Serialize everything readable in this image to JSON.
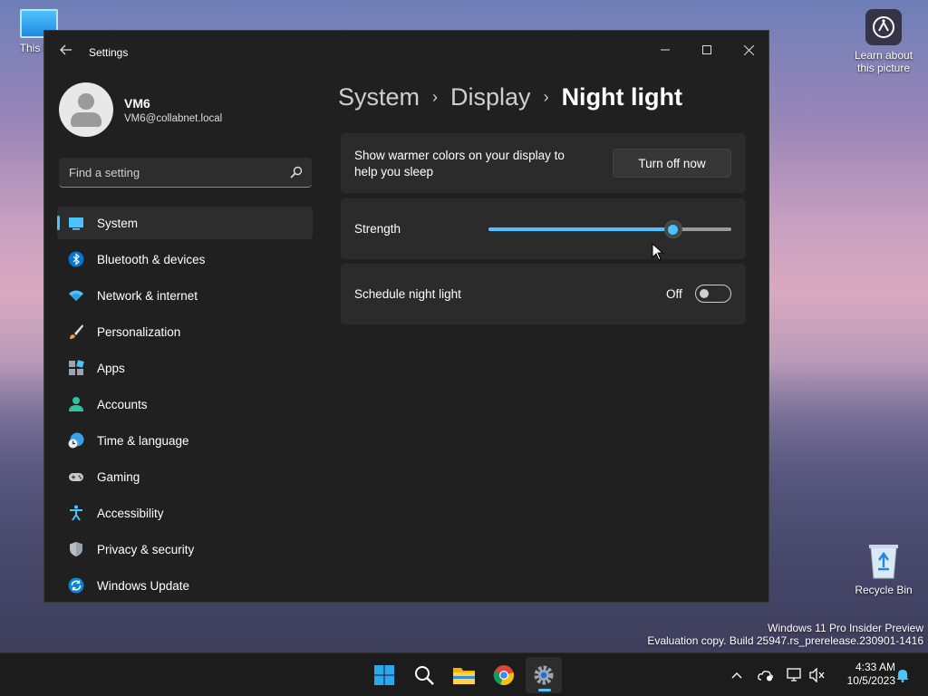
{
  "desktop": {
    "icons": [
      {
        "label": "This PC"
      },
      {
        "label": "Learn about this picture"
      },
      {
        "label": "Recycle Bin"
      }
    ],
    "watermark": {
      "line1": "Windows 11 Pro Insider Preview",
      "line2": "Evaluation copy. Build 25947.rs_prerelease.230901-1416"
    }
  },
  "window": {
    "title": "Settings",
    "user": {
      "name": "VM6",
      "email": "VM6@collabnet.local"
    },
    "search": {
      "placeholder": "Find a setting"
    },
    "nav": [
      {
        "label": "System",
        "icon": "monitor-icon",
        "selected": true
      },
      {
        "label": "Bluetooth & devices",
        "icon": "bluetooth-icon"
      },
      {
        "label": "Network & internet",
        "icon": "wifi-icon"
      },
      {
        "label": "Personalization",
        "icon": "brush-icon"
      },
      {
        "label": "Apps",
        "icon": "apps-icon"
      },
      {
        "label": "Accounts",
        "icon": "person-icon"
      },
      {
        "label": "Time & language",
        "icon": "globe-clock-icon"
      },
      {
        "label": "Gaming",
        "icon": "gamepad-icon"
      },
      {
        "label": "Accessibility",
        "icon": "accessibility-icon"
      },
      {
        "label": "Privacy & security",
        "icon": "shield-icon"
      },
      {
        "label": "Windows Update",
        "icon": "update-icon"
      }
    ],
    "breadcrumb": {
      "items": [
        "System",
        "Display"
      ],
      "current": "Night light"
    },
    "cards": {
      "night_light": {
        "label": "Show warmer colors on your display to help you sleep",
        "button": "Turn off now"
      },
      "strength": {
        "label": "Strength",
        "value_percent": 76
      },
      "schedule": {
        "label": "Schedule night light",
        "state": "Off",
        "on": false
      }
    }
  },
  "taskbar": {
    "apps": [
      "start-icon",
      "search-icon",
      "file-explorer-icon",
      "chrome-icon",
      "settings-icon"
    ],
    "active_app": "settings-icon",
    "clock": {
      "time": "4:33 AM",
      "date": "10/5/2023"
    }
  },
  "colors": {
    "accent": "#4cc2ff",
    "window_bg": "#202020",
    "card_bg": "#2b2b2b"
  }
}
